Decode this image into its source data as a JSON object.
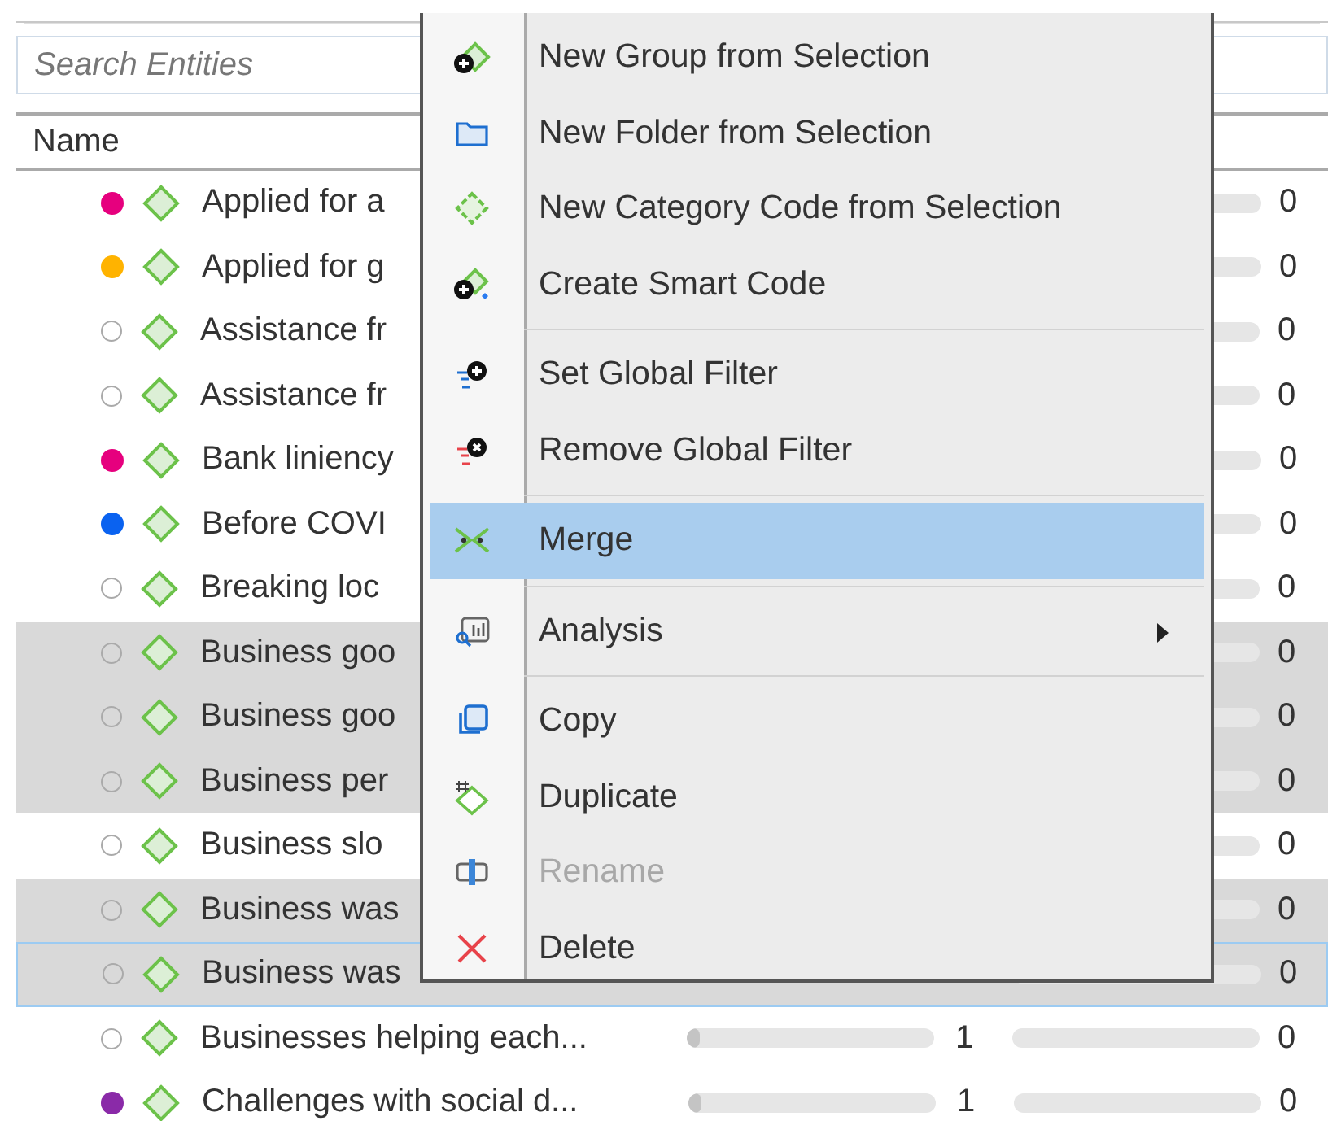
{
  "search": {
    "placeholder": "Search Entities"
  },
  "table": {
    "columns": [
      "Name"
    ],
    "rows": [
      {
        "name": "Applied for a",
        "color": "#e6007e",
        "selected": false,
        "focused": false,
        "count_2": "0"
      },
      {
        "name": "Applied for g",
        "color": "#ffb300",
        "selected": false,
        "focused": false,
        "count_2": "0"
      },
      {
        "name": "Assistance fr",
        "selected": false,
        "focused": false,
        "count_2": "0"
      },
      {
        "name": "Assistance fr",
        "selected": false,
        "focused": false,
        "count_2": "0"
      },
      {
        "name": "Bank liniency",
        "color": "#e6007e",
        "selected": false,
        "focused": false,
        "count_2": "0"
      },
      {
        "name": "Before COVI",
        "color": "#0a62f0",
        "selected": false,
        "focused": false,
        "count_2": "0"
      },
      {
        "name": "Breaking loc",
        "selected": false,
        "focused": false,
        "count_2": "0"
      },
      {
        "name": "Business goo",
        "selected": true,
        "focused": false,
        "count_2": "0"
      },
      {
        "name": "Business goo",
        "selected": true,
        "focused": false,
        "count_2": "0"
      },
      {
        "name": "Business per",
        "selected": true,
        "focused": false,
        "count_2": "0"
      },
      {
        "name": "Business slo",
        "selected": false,
        "focused": false,
        "count_2": "0"
      },
      {
        "name": "Business was",
        "selected": true,
        "focused": false,
        "count_2": "0"
      },
      {
        "name": "Business was",
        "selected": true,
        "focused": true,
        "count_2": "0"
      },
      {
        "name": "Businesses helping each...",
        "selected": false,
        "focused": false,
        "bar_1": {
          "level": 0.05
        },
        "count_1": "1",
        "count_2": "0"
      },
      {
        "name": "Challenges with social d...",
        "color": "#8a2aa8",
        "selected": false,
        "focused": false,
        "bar_1": {
          "level": 0.05
        },
        "count_1": "1",
        "count_2": "0"
      }
    ]
  },
  "context_menu": {
    "items": [
      {
        "label": "New Group from Selection",
        "selected": false,
        "disabled": false,
        "separator_after": false
      },
      {
        "label": "New Folder from Selection",
        "selected": false,
        "disabled": false,
        "separator_after": false
      },
      {
        "label": "New Category Code from Selection",
        "selected": false,
        "disabled": false,
        "separator_after": false
      },
      {
        "label": "Create Smart Code",
        "selected": false,
        "disabled": false,
        "separator_after": true
      },
      {
        "label": "Set Global Filter",
        "selected": false,
        "disabled": false,
        "separator_after": false
      },
      {
        "label": "Remove Global Filter",
        "selected": false,
        "disabled": false,
        "separator_after": true
      },
      {
        "label": "Merge",
        "selected": true,
        "disabled": false,
        "separator_after": true
      },
      {
        "label": "Analysis",
        "selected": false,
        "disabled": false,
        "separator_after": true,
        "submenu": true
      },
      {
        "label": "Copy",
        "selected": false,
        "disabled": false,
        "separator_after": false
      },
      {
        "label": "Duplicate",
        "selected": false,
        "disabled": false,
        "separator_after": false
      },
      {
        "label": "Rename",
        "selected": false,
        "disabled": true,
        "separator_after": false
      },
      {
        "label": "Delete",
        "selected": false,
        "disabled": false,
        "separator_after": false
      }
    ]
  }
}
